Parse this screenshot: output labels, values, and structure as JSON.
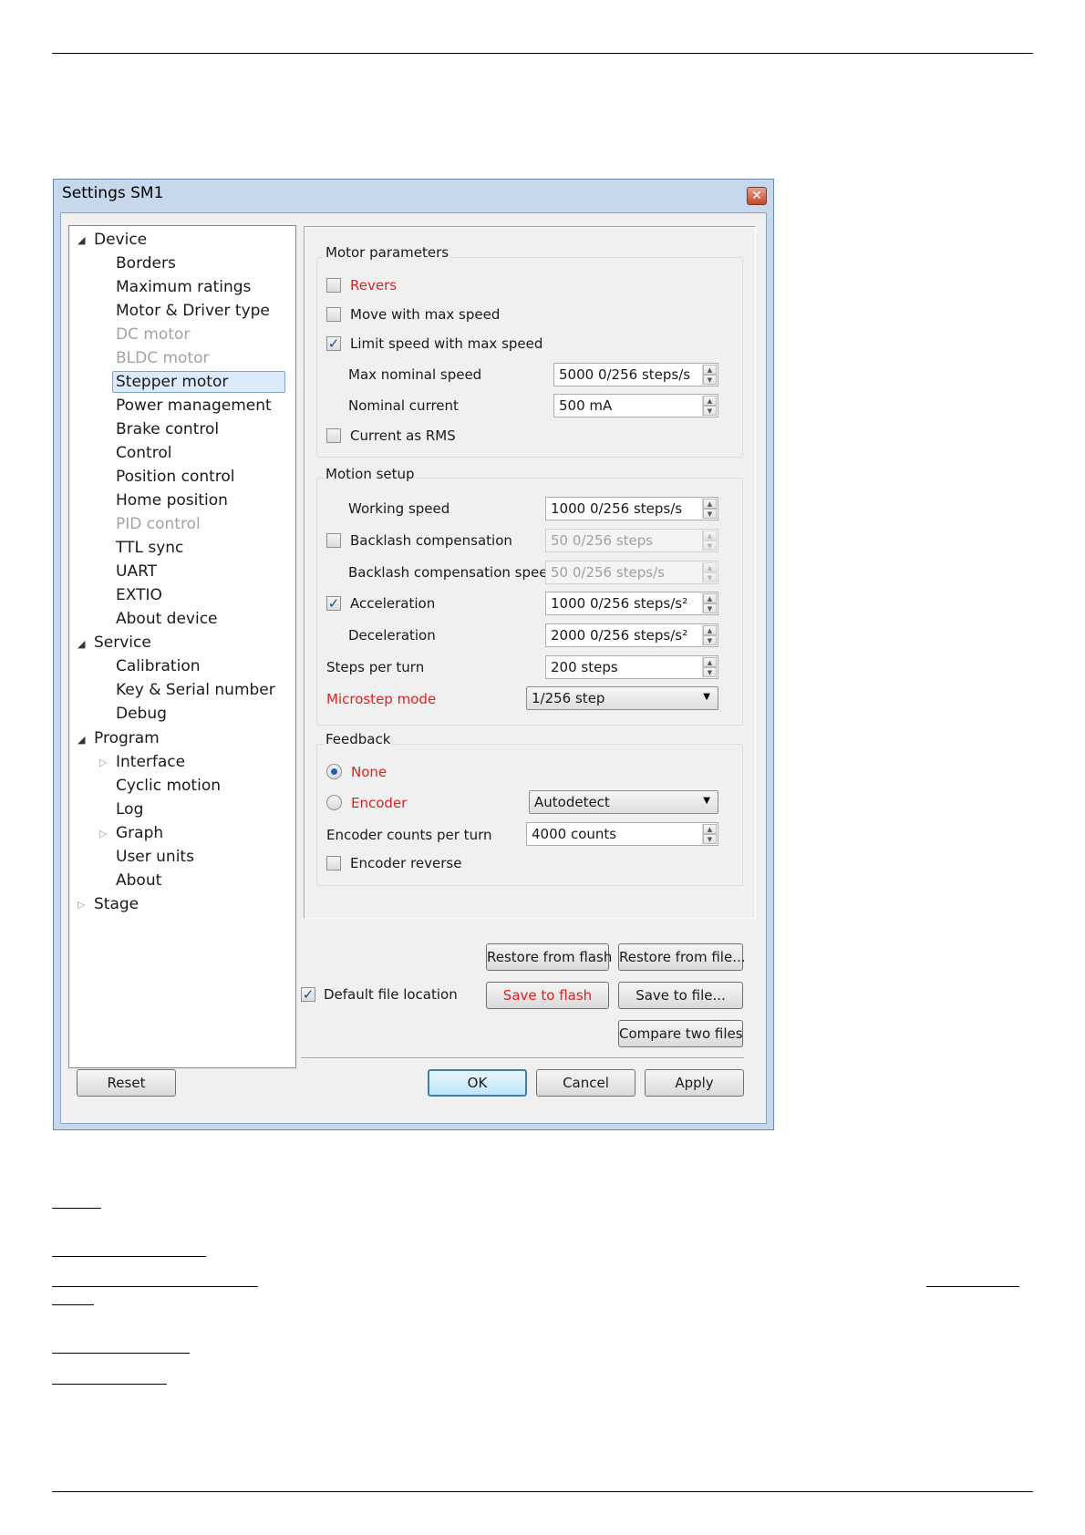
{
  "dialog": {
    "title": "Settings SM1",
    "close_label": "✕"
  },
  "tree": {
    "device": "Device",
    "borders": "Borders",
    "maximum_ratings": "Maximum ratings",
    "motor_driver_type": "Motor & Driver type",
    "dc_motor": "DC motor",
    "bldc_motor": "BLDC motor",
    "stepper_motor": "Stepper motor",
    "power_management": "Power management",
    "brake_control": "Brake control",
    "control": "Control",
    "position_control": "Position control",
    "home_position": "Home position",
    "pid_control": "PID control",
    "ttl_sync": "TTL sync",
    "uart": "UART",
    "extio": "EXTIO",
    "about_device": "About device",
    "service": "Service",
    "calibration": "Calibration",
    "key_serial": "Key & Serial number",
    "debug": "Debug",
    "program": "Program",
    "interface": "Interface",
    "cyclic_motion": "Cyclic motion",
    "log": "Log",
    "graph": "Graph",
    "user_units": "User units",
    "about": "About",
    "stage": "Stage"
  },
  "motor_parameters": {
    "title": "Motor parameters",
    "revers": "Revers",
    "move_max_speed": "Move with max speed",
    "limit_speed": "Limit speed with max speed",
    "max_nominal_speed_label": "Max nominal speed",
    "max_nominal_speed_value": "5000 0/256 steps/s",
    "nominal_current_label": "Nominal current",
    "nominal_current_value": "500 mA",
    "current_rms": "Current as RMS",
    "checks": {
      "revers": false,
      "move_max_speed": false,
      "limit_speed": true,
      "current_rms": false
    }
  },
  "motion_setup": {
    "title": "Motion setup",
    "working_speed_label": "Working speed",
    "working_speed_value": "1000 0/256 steps/s",
    "backlash_label": "Backlash compensation",
    "backlash_value": "50 0/256 steps",
    "backlash_speed_label": "Backlash compensation speed",
    "backlash_speed_value": "50 0/256 steps/s",
    "acceleration_label": "Acceleration",
    "acceleration_value": "1000 0/256 steps/s²",
    "deceleration_label": "Deceleration",
    "deceleration_value": "2000 0/256 steps/s²",
    "steps_per_turn_label": "Steps per turn",
    "steps_per_turn_value": "200 steps",
    "microstep_label": "Microstep mode",
    "microstep_value": "1/256 step",
    "checks": {
      "backlash": false,
      "acceleration": true
    }
  },
  "feedback": {
    "title": "Feedback",
    "none": "None",
    "encoder": "Encoder",
    "encoder_mode": "Autodetect",
    "counts_label": "Encoder counts per turn",
    "counts_value": "4000 counts",
    "encoder_reverse": "Encoder reverse",
    "selected": "None",
    "checks": {
      "encoder_reverse": false
    }
  },
  "file_actions": {
    "restore_flash": "Restore from flash",
    "restore_file": "Restore from file...",
    "default_location": "Default file location",
    "default_location_checked": true,
    "save_flash": "Save to flash",
    "save_file": "Save to file...",
    "compare": "Compare two files"
  },
  "footer": {
    "reset": "Reset",
    "ok": "OK",
    "cancel": "Cancel",
    "apply": "Apply"
  },
  "colors": {
    "warning_red": "#e02020",
    "selection_bg": "#dceafc",
    "disabled_text": "#a3a3a3"
  }
}
